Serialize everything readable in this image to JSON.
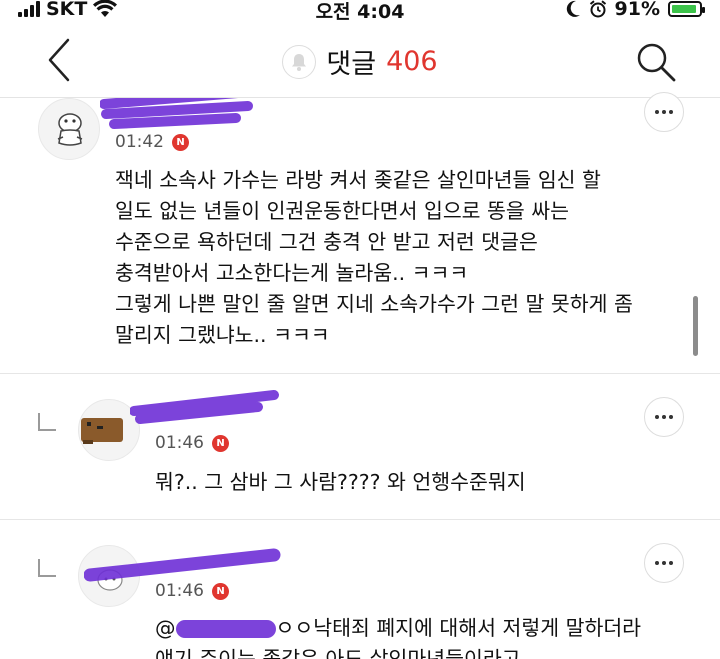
{
  "status_bar": {
    "carrier": "SKT",
    "time": "오전 4:04",
    "battery": "91%",
    "battery_level": 0.91
  },
  "header": {
    "title": "댓글",
    "count": "406"
  },
  "comments": [
    {
      "time": "01:42",
      "badge": "N",
      "text": "잭네 소속사 가수는 라방 켜서 좆같은 살인마년들 임신 할\n일도 없는 년들이 인권운동한다면서 입으로 똥을 싸는\n수준으로 욕하던데 그건 충격 안 받고 저런 댓글은\n충격받아서 고소한다는게 놀라움.. ㅋㅋㅋ\n그렇게 나쁜 말인 줄 알면 지네 소속가수가 그런 말 못하게 좀\n말리지 그랬냐노.. ㅋㅋㅋ"
    },
    {
      "time": "01:46",
      "badge": "N",
      "text": "뭐?.. 그 삼바 그 사람???? 와 언행수준뭐지"
    },
    {
      "time": "01:46",
      "badge": "N",
      "text_line1_prefix": "@",
      "text_line1": "ㅇㅇ낙태죄 폐지에 대해서 저렇게 말하더라",
      "text_line2": "얘기 주이는 좆같은 아도 살인마년들이라고"
    }
  ]
}
